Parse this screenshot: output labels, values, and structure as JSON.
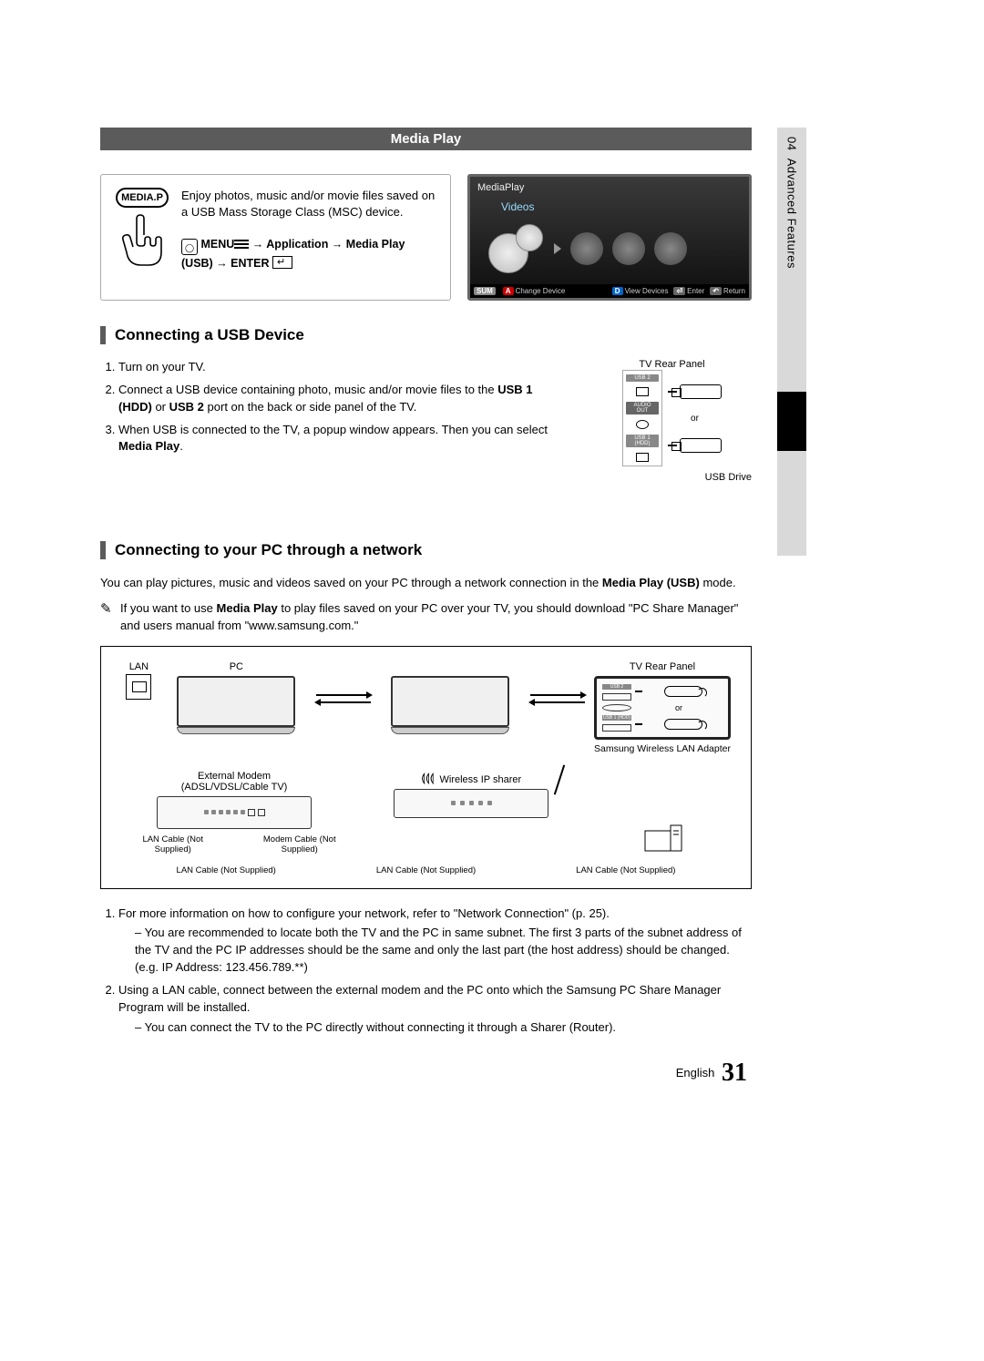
{
  "sidebar": {
    "chapter": "04",
    "label": "Advanced Features"
  },
  "header": {
    "title": "Media Play"
  },
  "intro": {
    "media_p_label": "MEDIA.P",
    "desc": "Enjoy photos, music and/or movie files saved on a USB Mass Storage Class (MSC) device.",
    "menu_path_1": "MENU",
    "menu_path_2": " → Application → Media Play (USB) → ENTER"
  },
  "tv_shot": {
    "title": "MediaPlay",
    "category": "Videos",
    "footer": {
      "sum": "SUM",
      "a": "A",
      "change": "Change Device",
      "d": "D",
      "view": "View Devices",
      "enter": "Enter",
      "return": "Return"
    }
  },
  "section_usb": {
    "heading": "Connecting a USB Device",
    "steps": [
      "Turn on your TV.",
      "Connect a USB device containing photo, music and/or movie files to the USB 1 (HDD) or USB 2 port on the back or side panel of the TV.",
      "When USB is connected to the TV, a popup window appears. Then you can select Media Play."
    ],
    "step2_bold1": "USB 1 (HDD)",
    "step2_bold2": "USB 2",
    "step3_bold": "Media Play",
    "diagram": {
      "panel_label": "TV Rear Panel",
      "port1": "USB 2",
      "port2": "AUDIO OUT",
      "port3": "USB 1 (HDD)",
      "or": "or",
      "drive_label": "USB Drive"
    }
  },
  "section_net": {
    "heading": "Connecting to your PC through a network",
    "para1_a": "You can play pictures, music and videos saved on your PC through a network connection in the ",
    "para1_bold": "Media Play (USB)",
    "para1_b": " mode.",
    "note_a": "If you want to use ",
    "note_bold": "Media Play",
    "note_b": " to play files saved on your PC over your TV, you should download \"PC Share Manager\" and users manual from \"www.samsung.com.\"",
    "diagram": {
      "lan": "LAN",
      "pc": "PC",
      "tv": "TV Rear Panel",
      "or": "or",
      "samsung_adapter": "Samsung Wireless LAN Adapter",
      "modem_label": "External Modem",
      "modem_sub": "(ADSL/VDSL/Cable TV)",
      "router": "Wireless IP sharer",
      "usb2": "USB 2",
      "usb1": "USB 1 (HDD)",
      "cable_lan": "LAN Cable (Not Supplied)",
      "cable_modem": "Modem Cable (Not Supplied)"
    },
    "steps": [
      "For more information on how to configure your network, refer to \"Network Connection\" (p. 25).",
      "Using a LAN cable, connect between the external modem and the PC onto which the Samsung PC Share Manager Program will be installed."
    ],
    "sub1": "You are recommended to locate both the TV and the PC in same subnet. The first 3 parts of the subnet address of the TV and the PC IP addresses should be the same and only the last part (the host address) should be changed. (e.g. IP Address: 123.456.789.**)",
    "sub2": "You can connect the TV to the PC directly without connecting it through a Sharer (Router)."
  },
  "footer": {
    "lang": "English",
    "page": "31"
  }
}
